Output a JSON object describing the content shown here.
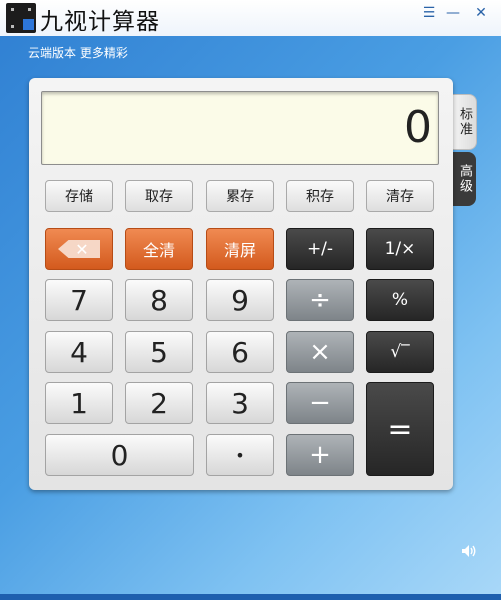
{
  "window": {
    "title": "九视计算器",
    "subtitle": "云端版本 更多精彩",
    "controls": {
      "menu": "☰",
      "minimize": "—",
      "close": "✕"
    }
  },
  "display": {
    "value": "0"
  },
  "tabs": {
    "standard": "标准",
    "advanced": "高级"
  },
  "memory_buttons": [
    "存储",
    "取存",
    "累存",
    "积存",
    "清存"
  ],
  "keys": {
    "backspace": "✕",
    "all_clear": "全清",
    "clear_screen": "清屏",
    "sign": "+/-",
    "reciprocal": "1/×",
    "n7": "7",
    "n8": "8",
    "n9": "9",
    "divide": "÷",
    "percent": "%",
    "n4": "4",
    "n5": "5",
    "n6": "6",
    "multiply": "×",
    "sqrt": "√‾",
    "n1": "1",
    "n2": "2",
    "n3": "3",
    "minus": "−",
    "equals": "=",
    "n0": "0",
    "dot": "•",
    "plus": "+"
  },
  "icons": {
    "speaker": "speaker-icon"
  }
}
